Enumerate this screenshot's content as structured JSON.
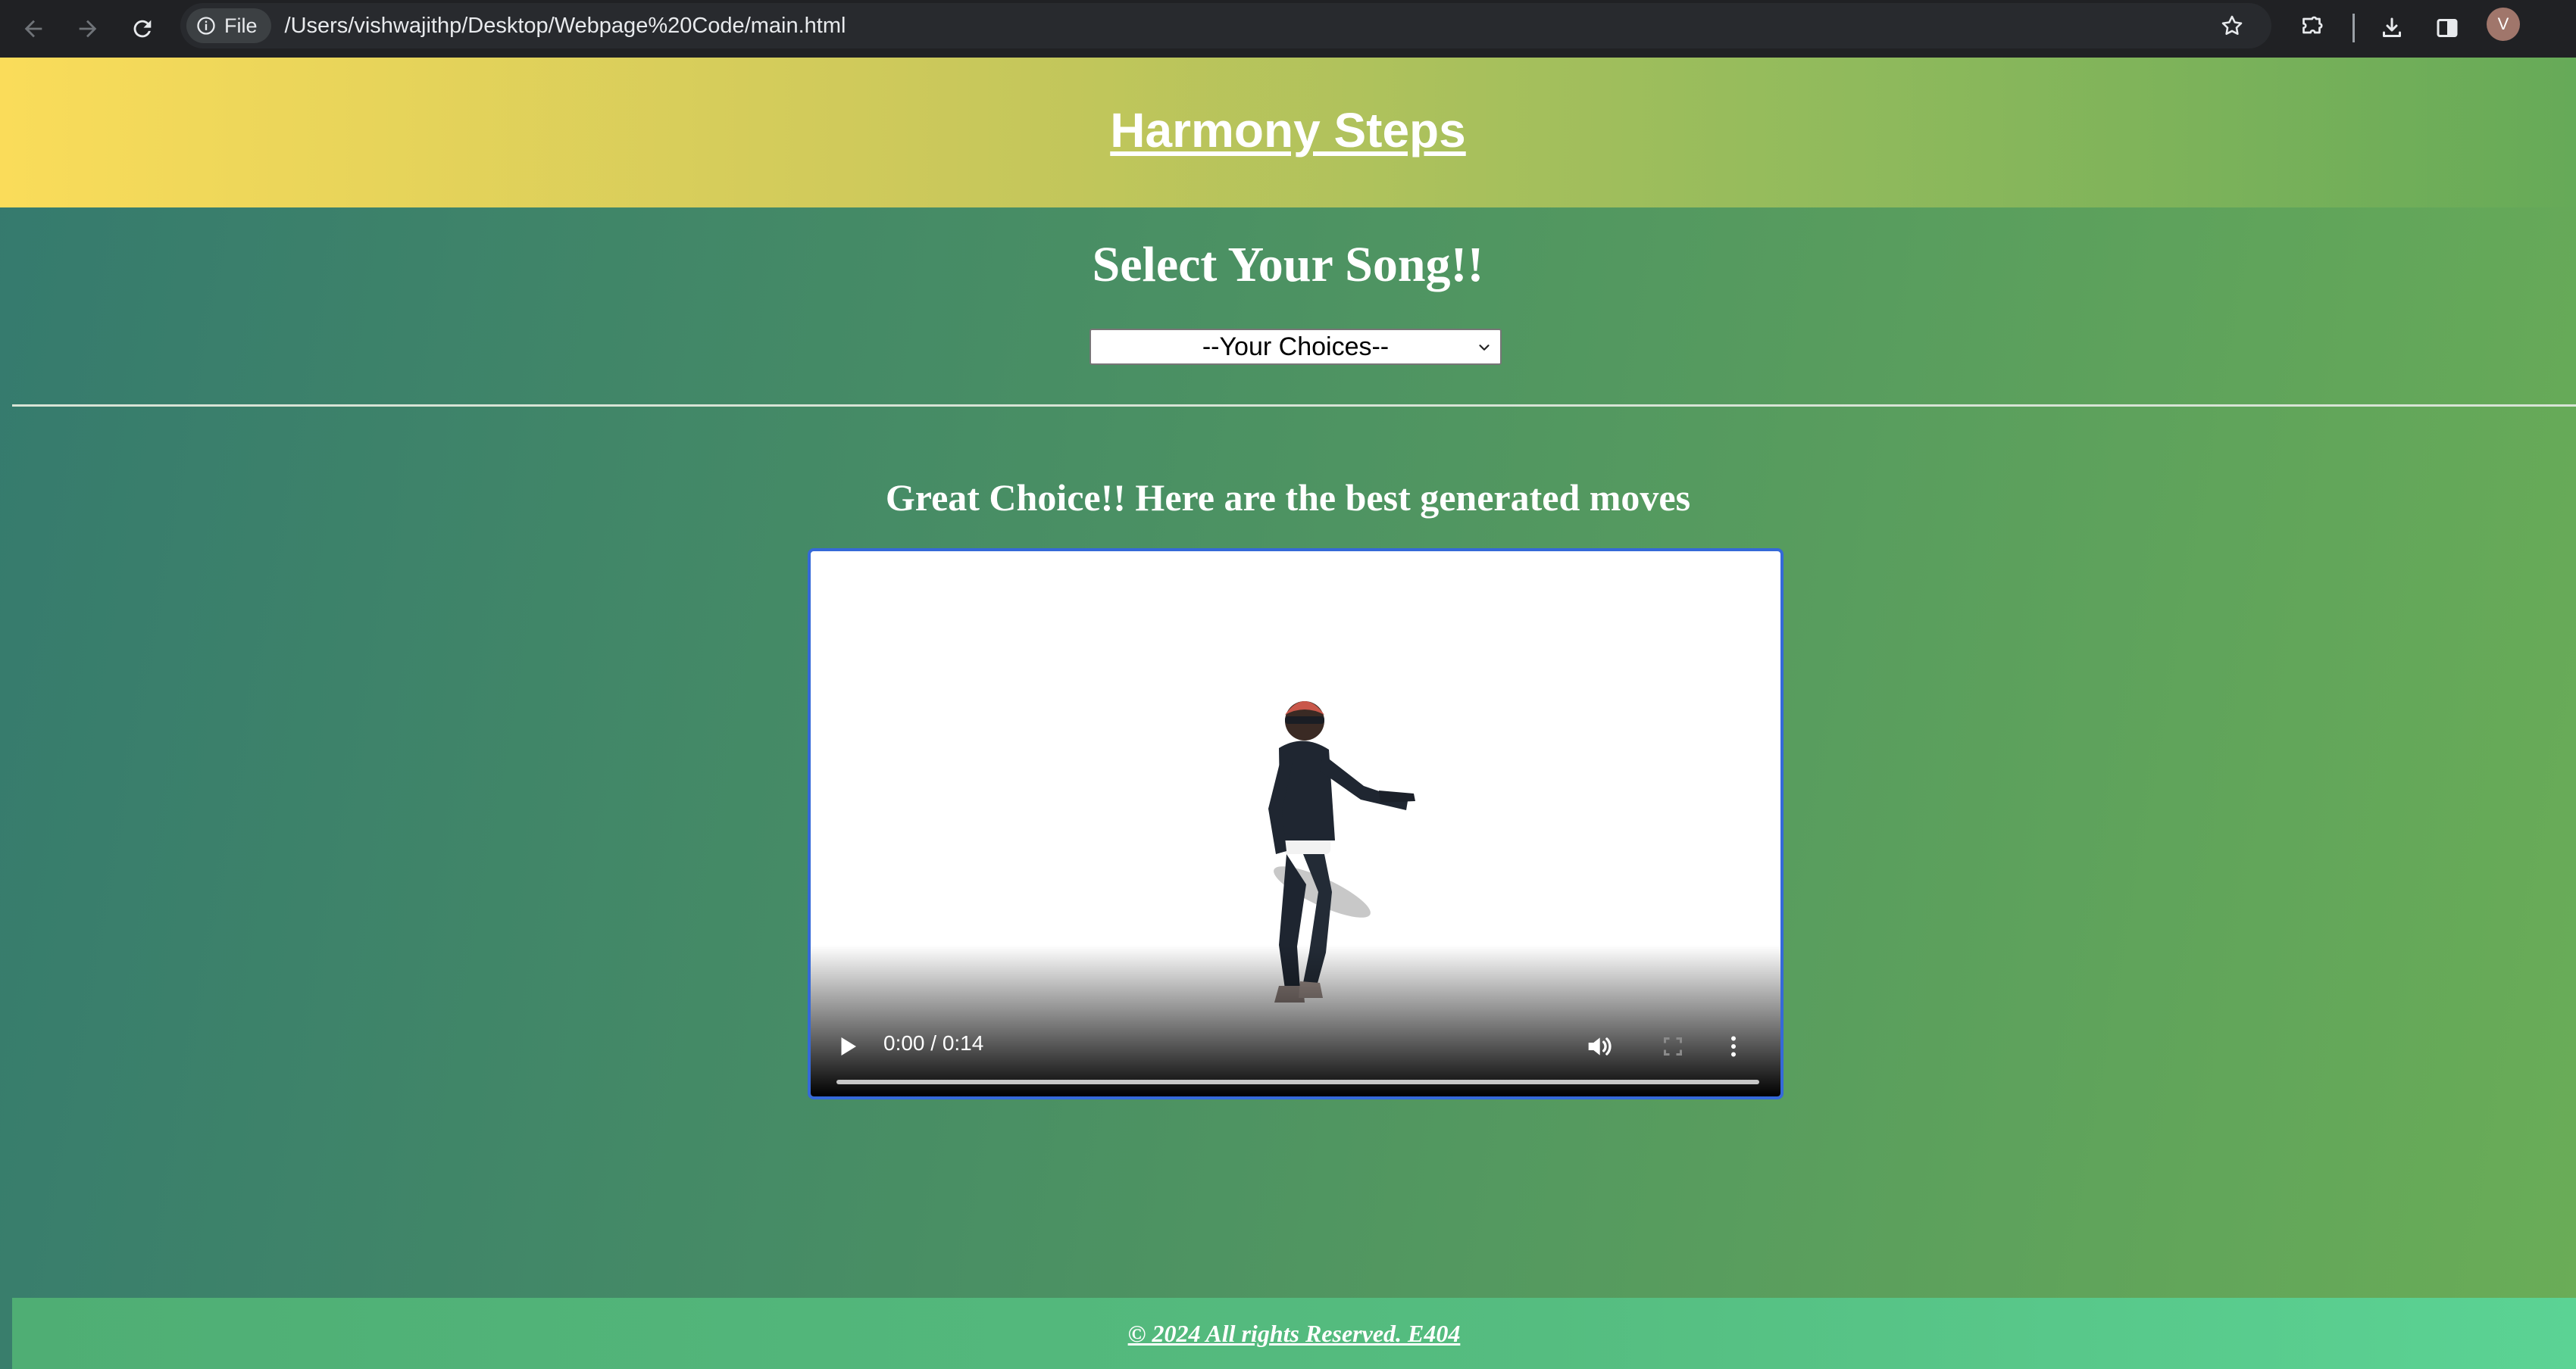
{
  "browser": {
    "file_chip_label": "File",
    "url": "/Users/vishwajithp/Desktop/Webpage%20Code/main.html",
    "profile_initial": "V",
    "icons": [
      "back-arrow-icon",
      "forward-arrow-icon",
      "reload-icon",
      "info-icon",
      "star-icon",
      "extensions-icon",
      "download-icon",
      "side-panel-icon"
    ]
  },
  "header": {
    "title": "Harmony Steps"
  },
  "song_picker": {
    "heading": "Select Your Song!!",
    "selected": "--Your Choices--"
  },
  "result": {
    "heading": "Great Choice!! Here are the best generated moves"
  },
  "video": {
    "time": "0:00 / 0:14",
    "progress": 0
  },
  "footer": {
    "text": "© 2024 All rights Reserved. E404"
  },
  "colors": {
    "header_gradient_start": "#fadc5a",
    "header_gradient_end": "#66aa58",
    "page_gradient_start": "#357a6e",
    "page_gradient_end": "#6aad57",
    "footer_gradient_end": "#5bd394",
    "video_focus_border": "#3569d8"
  }
}
